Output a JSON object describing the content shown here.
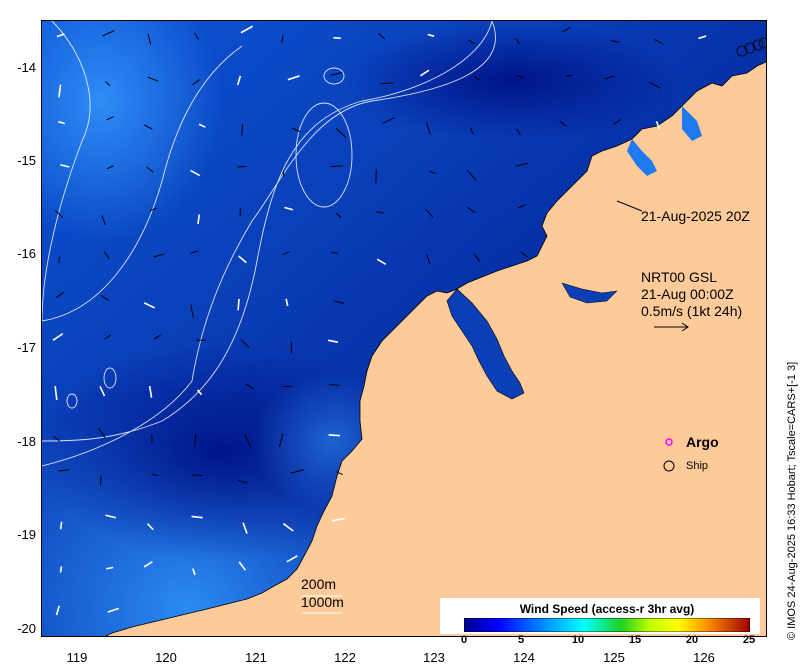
{
  "map": {
    "lon_ticks": [
      "119",
      "120",
      "121",
      "122",
      "123",
      "124",
      "125",
      "126"
    ],
    "lat_ticks": [
      "-14",
      "-15",
      "-16",
      "-17",
      "-18",
      "-19",
      "-20"
    ],
    "lon_range": [
      118.6,
      126.7
    ],
    "lat_range": [
      -20.2,
      -13.55
    ]
  },
  "annotations": {
    "ship_track_label": "21-Aug-2025 20Z",
    "model_line1": "NRT00 GSL",
    "model_line2": "21-Aug 00:00Z",
    "model_line3": "0.5m/s (1kt 24h)",
    "contour_200": "200m",
    "contour_1000": "1000m"
  },
  "legend": {
    "argo_label": "Argo",
    "ship_label": "Ship",
    "argo_color": "#ff00ff"
  },
  "colorbar": {
    "title": "Wind Speed (access-r 3hr avg)",
    "ticks": [
      "0",
      "5",
      "10",
      "15",
      "20",
      "25"
    ]
  },
  "credit": "© IMOS 24-Aug-2025 16:33 Hobart; Tscale=CARS+[-1 3]",
  "colors": {
    "land": "#fdcb9a",
    "ocean_deep": "#001a8c",
    "ocean_mid": "#0a4fd0",
    "ocean_light": "#1f7af0"
  }
}
